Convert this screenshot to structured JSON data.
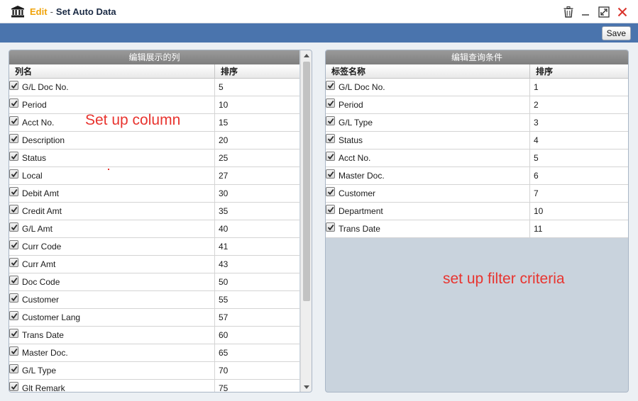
{
  "window": {
    "mode": "Edit",
    "separator": "-",
    "title": "Set Auto Data",
    "icons": [
      "bank-icon",
      "trash-icon",
      "minimize-icon",
      "maximize-icon",
      "close-icon"
    ]
  },
  "toolbar": {
    "save_label": "Save"
  },
  "left_panel": {
    "title": "编辑展示的列",
    "col_name": "列名",
    "col_order": "排序",
    "rows": [
      {
        "label": "G/L Doc No.",
        "order": "5"
      },
      {
        "label": "Period",
        "order": "10"
      },
      {
        "label": "Acct No.",
        "order": "15"
      },
      {
        "label": "Description",
        "order": "20"
      },
      {
        "label": "Status",
        "order": "25"
      },
      {
        "label": "Local",
        "order": "27"
      },
      {
        "label": "Debit Amt",
        "order": "30"
      },
      {
        "label": "Credit Amt",
        "order": "35"
      },
      {
        "label": "G/L Amt",
        "order": "40"
      },
      {
        "label": "Curr Code",
        "order": "41"
      },
      {
        "label": "Curr Amt",
        "order": "43"
      },
      {
        "label": "Doc Code",
        "order": "50"
      },
      {
        "label": "Customer",
        "order": "55"
      },
      {
        "label": "Customer Lang",
        "order": "57"
      },
      {
        "label": "Trans Date",
        "order": "60"
      },
      {
        "label": "Master Doc.",
        "order": "65"
      },
      {
        "label": "G/L Type",
        "order": "70"
      },
      {
        "label": "Glt Remark",
        "order": "75"
      }
    ]
  },
  "right_panel": {
    "title": "编辑查询条件",
    "col_name": "标签名称",
    "col_order": "排序",
    "rows": [
      {
        "label": "G/L Doc No.",
        "order": "1"
      },
      {
        "label": "Period",
        "order": "2"
      },
      {
        "label": "G/L Type",
        "order": "3"
      },
      {
        "label": "Status",
        "order": "4"
      },
      {
        "label": "Acct No.",
        "order": "5"
      },
      {
        "label": "Master Doc.",
        "order": "6"
      },
      {
        "label": "Customer",
        "order": "7"
      },
      {
        "label": "Department",
        "order": "10"
      },
      {
        "label": "Trans Date",
        "order": "11"
      }
    ]
  },
  "annotations": {
    "left": "Set up column",
    "right": "set up filter criteria"
  },
  "colors": {
    "mode_accent": "#f0a30a",
    "toolbar": "#4a74ad",
    "annotation": "#e8342f",
    "close": "#d9322b"
  }
}
